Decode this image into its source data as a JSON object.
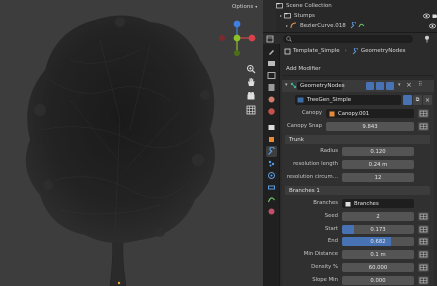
{
  "viewport": {
    "options_label": "Options"
  },
  "outliner": {
    "rows": [
      {
        "label": "Scene Collection"
      },
      {
        "label": "Stumps"
      },
      {
        "label": "BezierCurve.018"
      }
    ]
  },
  "properties": {
    "breadcrumb": [
      "Template_Simple",
      "GeometryNodes"
    ],
    "add_modifier": "Add Modifier"
  },
  "modifier": {
    "name": "GeometryNodes",
    "node_group": "TreeGen_Simple",
    "fields": {
      "canopy_label": "Canopy",
      "canopy_value": "Canopy.001",
      "canopy_snap_label": "Canopy Snap",
      "canopy_snap_value": "9.843",
      "trunk_section": "Trunk",
      "radius_label": "Radius",
      "radius_value": "0.120",
      "res_length_label": "resolution length",
      "res_length_value": "0.24 m",
      "res_circum_label": "resolution circum…",
      "res_circum_value": "12",
      "branches_section": "Branches 1",
      "branches_label": "Branches",
      "branches_value": "Branches",
      "seed_label": "Seed",
      "seed_value": "2",
      "start_label": "Start",
      "start_value": "0.173",
      "start_fraction": 0.173,
      "end_label": "End",
      "end_value": "0.682",
      "end_fraction": 0.682,
      "min_distance_label": "Min Distance",
      "min_distance_value": "0.1 m",
      "density_label": "Density %",
      "density_value": "60.000",
      "slope_min_label": "Slope Min",
      "slope_min_value": "0.000"
    }
  },
  "colors": {
    "accent": "#4772b3",
    "gizmo_x": "#d8434a",
    "gizmo_y": "#8bc22a",
    "gizmo_z": "#3f7fe0",
    "viewport_bg": "#3d3d3d"
  }
}
